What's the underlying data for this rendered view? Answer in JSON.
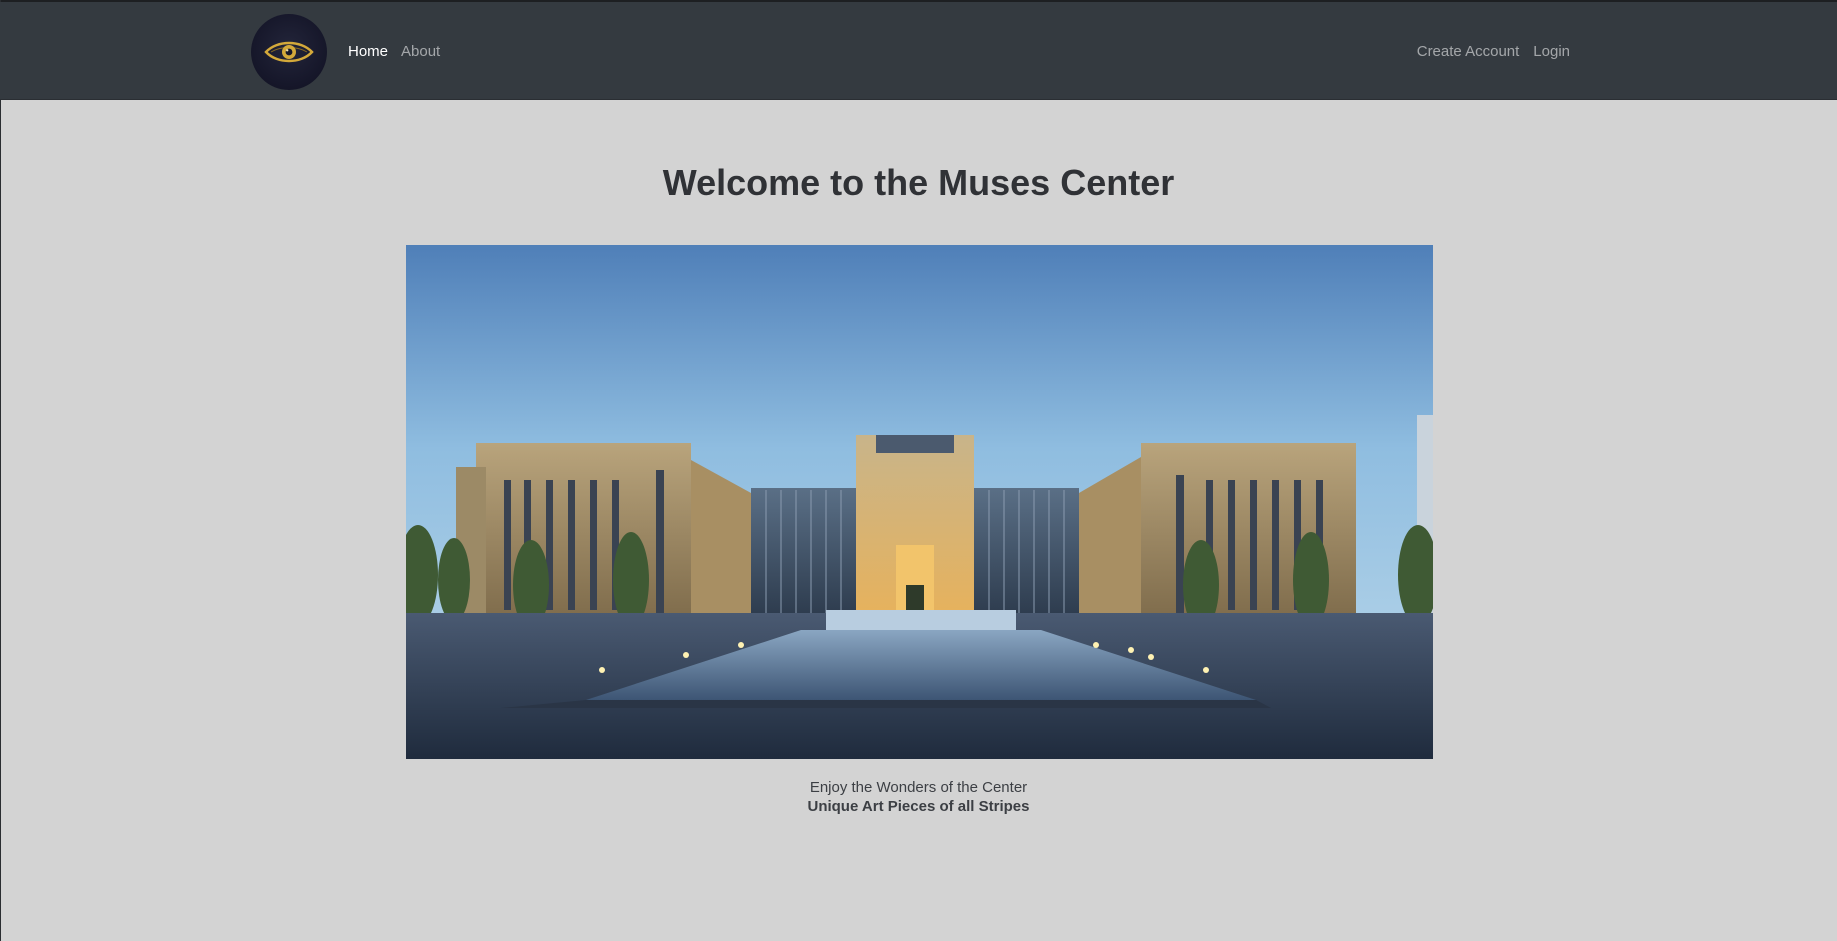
{
  "navbar": {
    "brand_icon": "eye-logo-icon",
    "left_links": [
      {
        "label": "Home",
        "active": true
      },
      {
        "label": "About",
        "active": false
      }
    ],
    "right_links": [
      {
        "label": "Create Account"
      },
      {
        "label": "Login"
      }
    ]
  },
  "main": {
    "title": "Welcome to the Muses Center",
    "caption": {
      "line1": "Enjoy the Wonders of the Center",
      "line2": "Unique Art Pieces of all Stripes"
    }
  },
  "colors": {
    "navbar_bg": "#343a40",
    "page_bg": "#d3d3d3",
    "logo_gold": "#d4a93a"
  }
}
